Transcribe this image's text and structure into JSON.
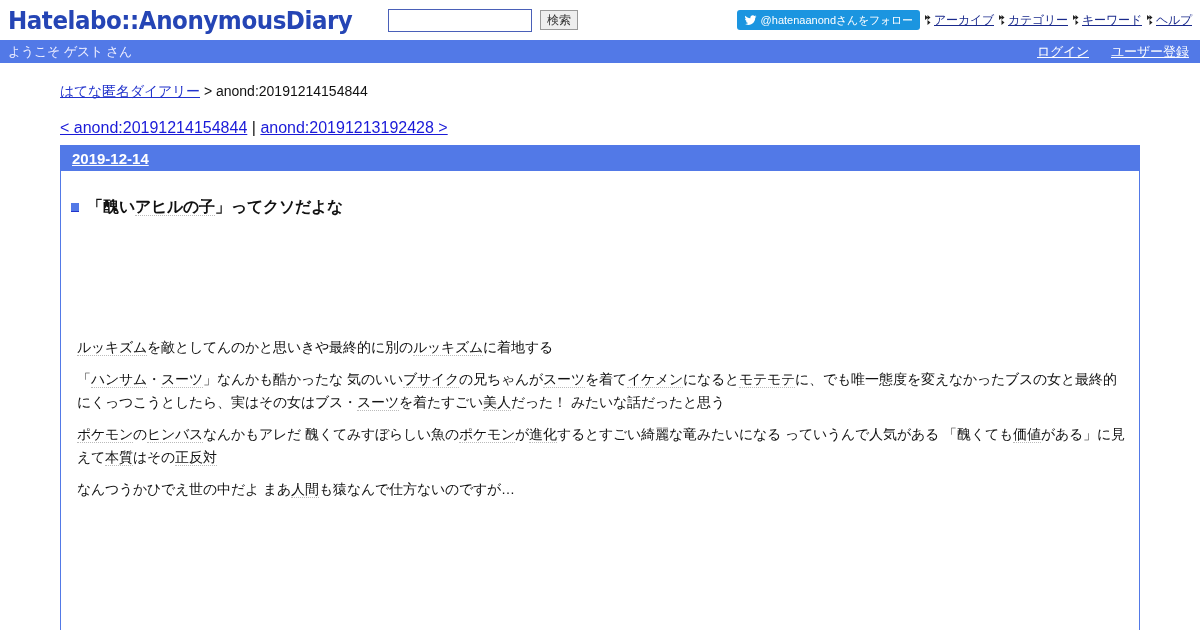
{
  "header": {
    "logo": "Hatelabo::AnonymousDiary",
    "search": {
      "button": "検索"
    },
    "follow_button": "@hatenaanondさんをフォロー",
    "nav_links": [
      "アーカイブ",
      "カテゴリー",
      "キーワード",
      "ヘルプ"
    ]
  },
  "user_bar": {
    "welcome": "ようこそ ゲスト さん",
    "links": [
      "ログイン",
      "ユーザー登録"
    ]
  },
  "breadcrumb": {
    "link": "はてな匿名ダイアリー",
    "current": "> anond:20191214154844"
  },
  "pager": {
    "prev": "< anond:20191214154844",
    "separator": "|",
    "next": "anond:20191213192428 >"
  },
  "day": {
    "date": "2019-12-14",
    "title": [
      {
        "text": "「醜い",
        "link": false
      },
      {
        "text": "アヒルの子",
        "link": true
      },
      {
        "text": "」ってクソだよな",
        "link": false
      }
    ],
    "paragraphs": [
      [
        {
          "text": "ルッキズム",
          "link": true
        },
        {
          "text": "を敵としてんのかと思いきや最終的に別の",
          "link": false
        },
        {
          "text": "ルッキズム",
          "link": true
        },
        {
          "text": "に着地する",
          "link": false
        }
      ],
      [
        {
          "text": "「",
          "link": false
        },
        {
          "text": "ハンサム",
          "link": true
        },
        {
          "text": "・",
          "link": false
        },
        {
          "text": "スーツ",
          "link": true
        },
        {
          "text": "」なんかも酷かったな 気のいい",
          "link": false
        },
        {
          "text": "ブサイク",
          "link": true
        },
        {
          "text": "の兄ちゃんが",
          "link": false
        },
        {
          "text": "スーツ",
          "link": true
        },
        {
          "text": "を着て",
          "link": false
        },
        {
          "text": "イケメン",
          "link": true
        },
        {
          "text": "になると",
          "link": false
        },
        {
          "text": "モテモテ",
          "link": true
        },
        {
          "text": "に、でも唯一態度を変えなかったブスの女と最終的にくっつこうとしたら、実はその女はブス・",
          "link": false
        },
        {
          "text": "スーツ",
          "link": true
        },
        {
          "text": "を着たすごい",
          "link": false
        },
        {
          "text": "美人",
          "link": true
        },
        {
          "text": "だった！ みたいな話だったと思う",
          "link": false
        }
      ],
      [
        {
          "text": "ポケモン",
          "link": true
        },
        {
          "text": "の",
          "link": false
        },
        {
          "text": "ヒンバス",
          "link": true
        },
        {
          "text": "なんかもアレだ 醜くてみすぼらしい魚の",
          "link": false
        },
        {
          "text": "ポケモン",
          "link": true
        },
        {
          "text": "が",
          "link": false
        },
        {
          "text": "進化",
          "link": true
        },
        {
          "text": "するとすごい綺麗な竜みたいになる っていうんで人気がある 「醜くても",
          "link": false
        },
        {
          "text": "価値",
          "link": true
        },
        {
          "text": "がある」に見えて",
          "link": false
        },
        {
          "text": "本質",
          "link": true
        },
        {
          "text": "はその",
          "link": false
        },
        {
          "text": "正反対",
          "link": true
        }
      ],
      [
        {
          "text": "なんつうかひでえ世の中だよ まあ",
          "link": false
        },
        {
          "text": "人間",
          "link": true
        },
        {
          "text": "も猿なんで仕方ないのですが…",
          "link": false
        }
      ]
    ]
  }
}
